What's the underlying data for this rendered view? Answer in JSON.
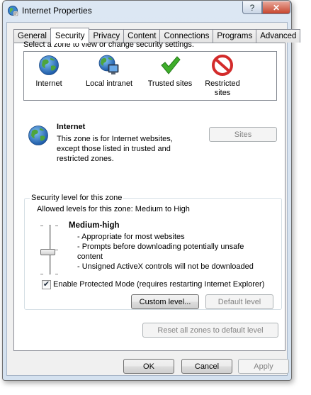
{
  "window": {
    "title": "Internet Properties",
    "help_glyph": "?",
    "close_glyph": "✕"
  },
  "tabs": [
    {
      "label": "General"
    },
    {
      "label": "Security",
      "active": true
    },
    {
      "label": "Privacy"
    },
    {
      "label": "Content"
    },
    {
      "label": "Connections"
    },
    {
      "label": "Programs"
    },
    {
      "label": "Advanced"
    }
  ],
  "security": {
    "instruction": "Select a zone to view or change security settings.",
    "zones": [
      {
        "label": "Internet",
        "icon": "globe-icon"
      },
      {
        "label": "Local intranet",
        "icon": "intranet-icon"
      },
      {
        "label": "Trusted sites",
        "icon": "checkmark-icon"
      },
      {
        "label": "Restricted sites",
        "icon": "restricted-icon"
      }
    ],
    "selected_zone": {
      "name": "Internet",
      "description": "This zone is for Internet websites, except those listed in trusted and restricted zones."
    },
    "sites_button": "Sites"
  },
  "level": {
    "group_title": "Security level for this zone",
    "allowed": "Allowed levels for this zone: Medium to High",
    "name": "Medium-high",
    "bullets": [
      "- Appropriate for most websites",
      "- Prompts before downloading potentially unsafe",
      "content",
      "- Unsigned ActiveX controls will not be downloaded"
    ],
    "slider_level": "Medium-high",
    "protected_mode": {
      "label": "Enable Protected Mode (requires restarting Internet Explorer)",
      "checked": true,
      "check_glyph": "✔"
    },
    "custom_level_button": "Custom level...",
    "default_level_button": "Default level"
  },
  "reset_all_button": "Reset all zones to default level",
  "footer": {
    "ok": "OK",
    "cancel": "Cancel",
    "apply": "Apply"
  },
  "colors": {
    "title_gradient_top": "#dce7f3",
    "close_button": "#c7452d",
    "globe_blue": "#2b6cb8",
    "globe_green": "#4ea53c",
    "check_green": "#3fae2a",
    "restricted_red": "#d32b2b"
  }
}
